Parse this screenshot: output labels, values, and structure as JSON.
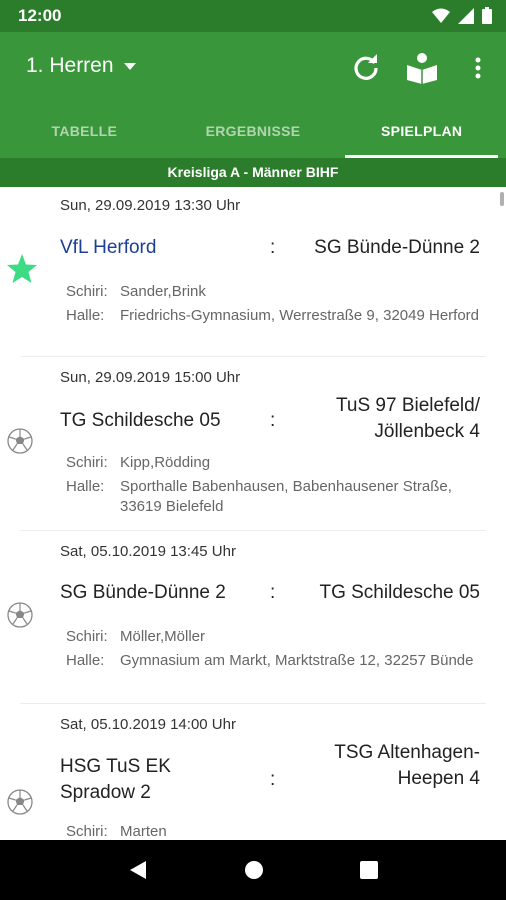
{
  "status_bar": {
    "time": "12:00"
  },
  "appbar": {
    "team_selector": "1. Herren"
  },
  "tabs": [
    {
      "label": "TABELLE",
      "active": false
    },
    {
      "label": "ERGEBNISSE",
      "active": false
    },
    {
      "label": "SPIELPLAN",
      "active": true
    }
  ],
  "league": "Kreisliga A - Männer BIHF",
  "matches": [
    {
      "datetime": "Sun, 29.09.2019 13:30 Uhr",
      "home": "VfL Herford",
      "separator": ":",
      "away": "SG Bünde-Dünne 2",
      "schiri_label": "Schiri:",
      "schiri": "Sander,Brink",
      "halle_label": "Halle:",
      "halle": "Friedrichs-Gymnasium, Werrestraße 9, 32049 Herford",
      "icon": "star-icon"
    },
    {
      "datetime": "Sun, 29.09.2019 15:00 Uhr",
      "home": "TG Schildesche 05",
      "separator": ":",
      "away": "TuS 97 Bielefeld/ Jöllenbeck 4",
      "schiri_label": "Schiri:",
      "schiri": "Kipp,Rödding",
      "halle_label": "Halle:",
      "halle": "Sporthalle Babenhausen, Babenhausener Straße, 33619 Bielefeld",
      "icon": "handball-icon"
    },
    {
      "datetime": "Sat, 05.10.2019 13:45 Uhr",
      "home": "SG Bünde-Dünne 2",
      "separator": ":",
      "away": "TG Schildesche 05",
      "schiri_label": "Schiri:",
      "schiri": "Möller,Möller",
      "halle_label": "Halle:",
      "halle": "Gymnasium am Markt, Marktstraße 12, 32257 Bünde",
      "icon": "handball-icon"
    },
    {
      "datetime": "Sat, 05.10.2019 14:00 Uhr",
      "home": "HSG TuS EK Spradow 2",
      "separator": ":",
      "away": "TSG Altenhagen-Heepen 4",
      "schiri_label": "Schiri:",
      "schiri": "Marten",
      "icon": "handball-icon"
    }
  ],
  "colors": {
    "primary": "#3a963a",
    "primary_dark": "#2b7d2b",
    "favorite_star": "#3ddc84",
    "home_link": "#1c3f94"
  }
}
